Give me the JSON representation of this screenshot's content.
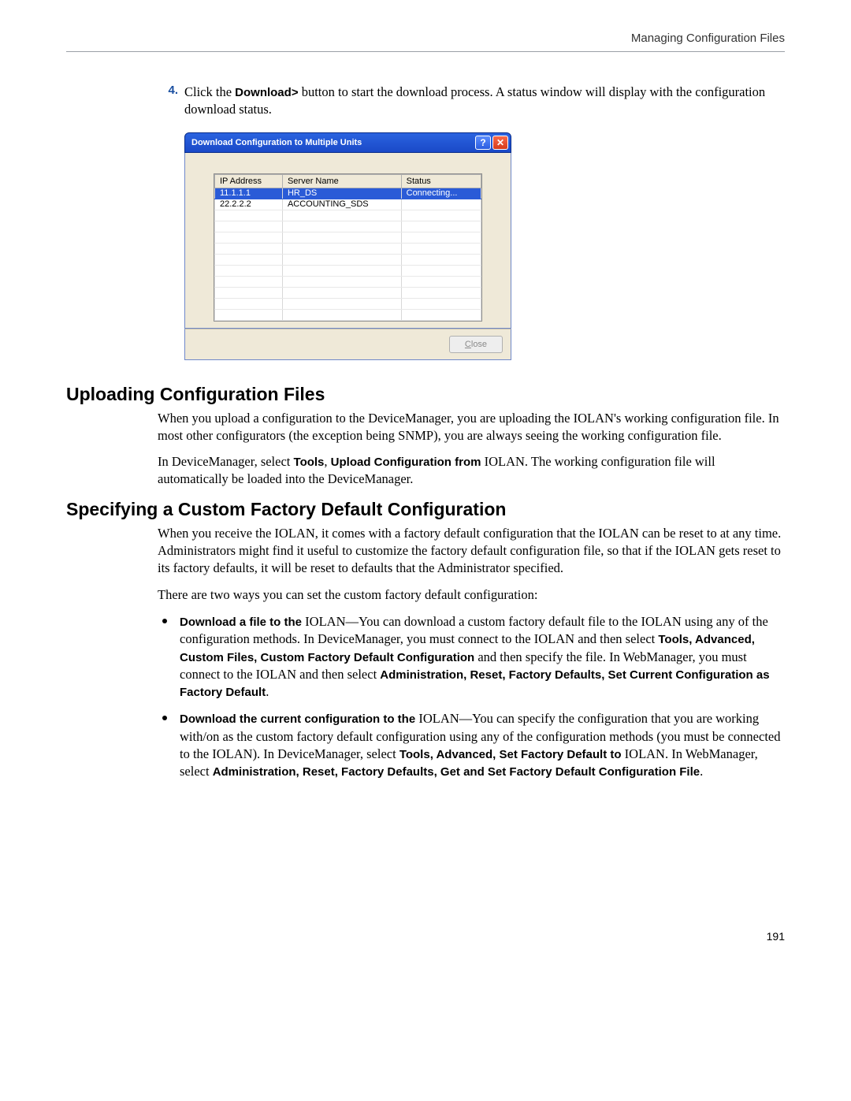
{
  "header": {
    "right": "Managing Configuration Files"
  },
  "step": {
    "num": "4.",
    "pre": "Click the ",
    "bold": "Download>",
    "post": " button to start the download process. A status window will display with the configuration download status."
  },
  "dialog": {
    "title": "Download Configuration to Multiple Units",
    "help": "?",
    "close": "✕",
    "columns": [
      "IP Address",
      "Server Name",
      "Status"
    ],
    "rows": [
      {
        "ip": "11.1.1.1",
        "name": "HR_DS",
        "status": "Connecting...",
        "selected": true
      },
      {
        "ip": "22.2.2.2",
        "name": "ACCOUNTING_SDS",
        "status": "",
        "selected": false
      }
    ],
    "blankRows": 10,
    "closeBtn": "Close"
  },
  "sec1": {
    "title": "Uploading Configuration Files",
    "p1": "When you upload a configuration to the DeviceManager, you are uploading the IOLAN's working configuration file. In most other configurators (the exception being SNMP), you are always seeing the working configuration file.",
    "p2a": "In DeviceManager, select ",
    "p2b_bold": "Tools",
    "p2c": ", ",
    "p2d_bold": "Upload Configuration from",
    "p2e": " IOLAN. The working configuration file will automatically be loaded into the DeviceManager."
  },
  "sec2": {
    "title": "Specifying a Custom Factory Default Configuration",
    "p1": "When you receive the IOLAN, it comes with a factory default configuration that the IOLAN can be reset to at any time. Administrators might find it useful to customize the factory default configuration file, so that if the IOLAN gets reset to its factory defaults, it will be reset to defaults that the Administrator specified.",
    "p2": "There are two ways you can set the custom factory default configuration:",
    "b1": {
      "lead_bold": "Download a file to the ",
      "t1": "IOLAN—You can download a custom factory default file to the IOLAN using any of the configuration methods. In DeviceManager, you must connect to the IOLAN and then select ",
      "m_bold": "Tools, Advanced, Custom Files, Custom Factory Default Configuration",
      "t2": " and then specify the file. In WebManager, you must connect to the IOLAN and then select ",
      "m2_bold": "Administration, Reset, Factory Defaults, Set Current Configuration as Factory Default",
      "t3": "."
    },
    "b2": {
      "lead_bold": "Download the current configuration to the ",
      "t1": "IOLAN—You can specify the configuration that you are working with/on as the custom factory default configuration using any of the configuration methods (you must be connected to the IOLAN). In DeviceManager, select ",
      "m_bold": "Tools, Advanced, Set Factory Default to",
      "t2": " IOLAN. In WebManager, select ",
      "m2_bold": "Administration, Reset, Factory Defaults, Get and Set Factory Default Configuration File",
      "t3": "."
    }
  },
  "pageNumber": "191"
}
